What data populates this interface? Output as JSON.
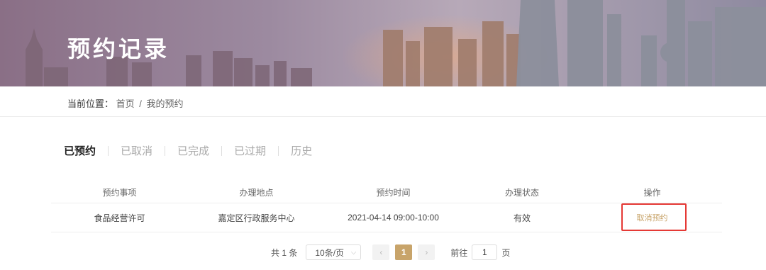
{
  "banner": {
    "title": "预约记录"
  },
  "breadcrumb": {
    "label": "当前位置：",
    "home": "首页",
    "separator": "/",
    "current": "我的预约"
  },
  "tabs": [
    {
      "label": "已预约",
      "active": true
    },
    {
      "label": "已取消",
      "active": false
    },
    {
      "label": "已完成",
      "active": false
    },
    {
      "label": "已过期",
      "active": false
    },
    {
      "label": "历史",
      "active": false
    }
  ],
  "table": {
    "headers": [
      "预约事项",
      "办理地点",
      "预约时间",
      "办理状态",
      "操作"
    ],
    "rows": [
      {
        "item": "食品经营许可",
        "location": "嘉定区行政服务中心",
        "time": "2021-04-14 09:00-10:00",
        "status": "有效",
        "action": "取消预约"
      }
    ]
  },
  "pagination": {
    "total": "共 1 条",
    "page_size": "10条/页",
    "prev_icon": "chevron-left-icon",
    "next_icon": "chevron-right-icon",
    "current_page": "1",
    "goto_label": "前往",
    "goto_value": "1",
    "page_suffix": "页"
  },
  "colors": {
    "accent": "#c8a46a",
    "highlight": "#e53935"
  }
}
